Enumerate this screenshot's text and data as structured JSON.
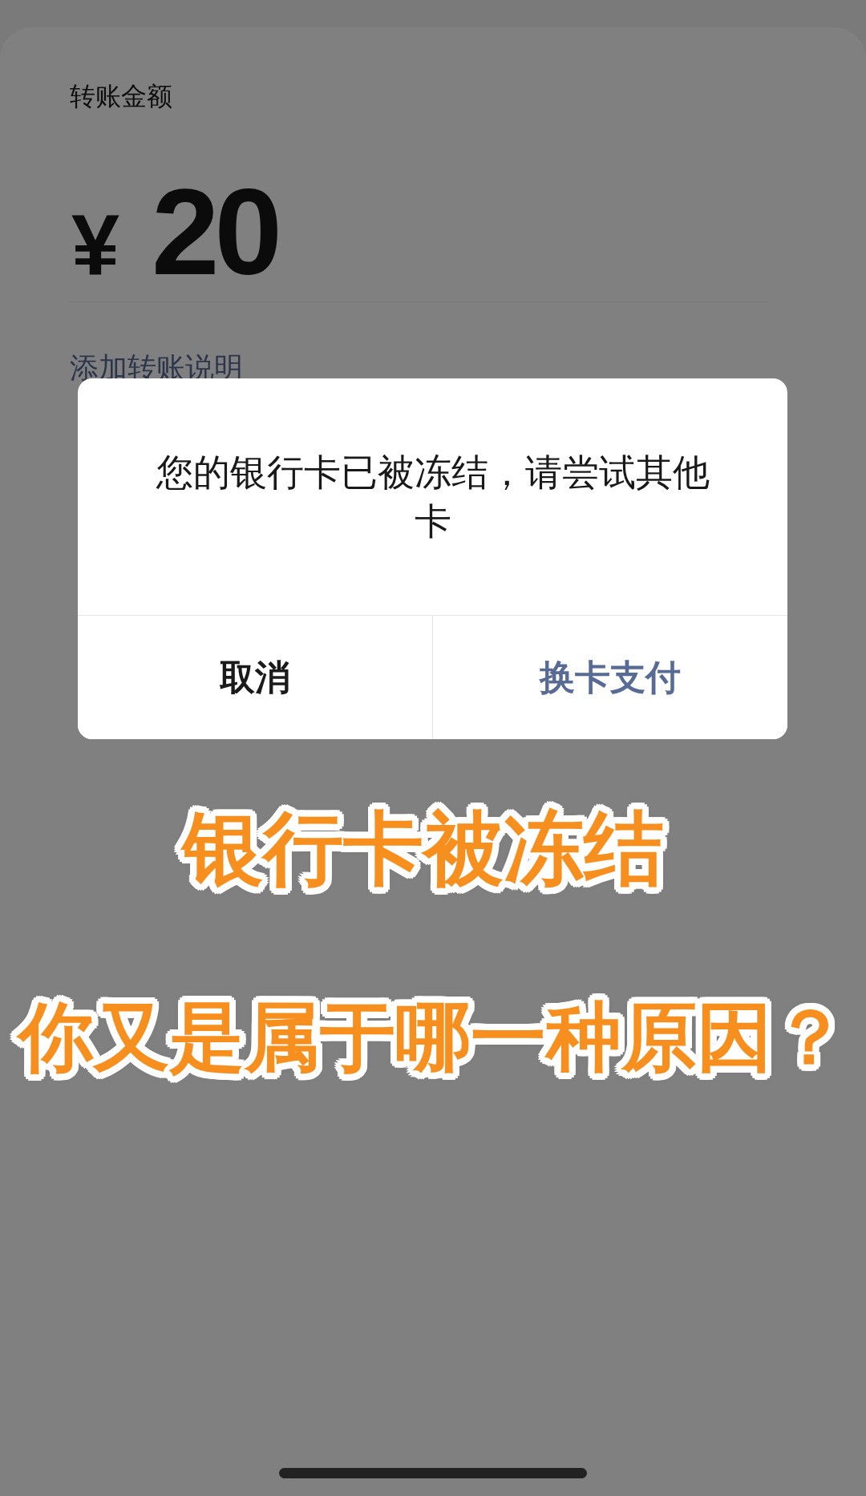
{
  "transfer": {
    "label": "转账金额",
    "currency": "¥",
    "amount": "20",
    "note_link": "添加转账说明"
  },
  "dialog": {
    "message": "您的银行卡已被冻结，请尝试其他卡",
    "buttons": [
      {
        "label": "取消",
        "kind": "cancel"
      },
      {
        "label": "换卡支付",
        "kind": "primary"
      }
    ]
  },
  "caption": {
    "lines": [
      "银行卡被冻结",
      "你又是属于哪一种原因？"
    ]
  }
}
